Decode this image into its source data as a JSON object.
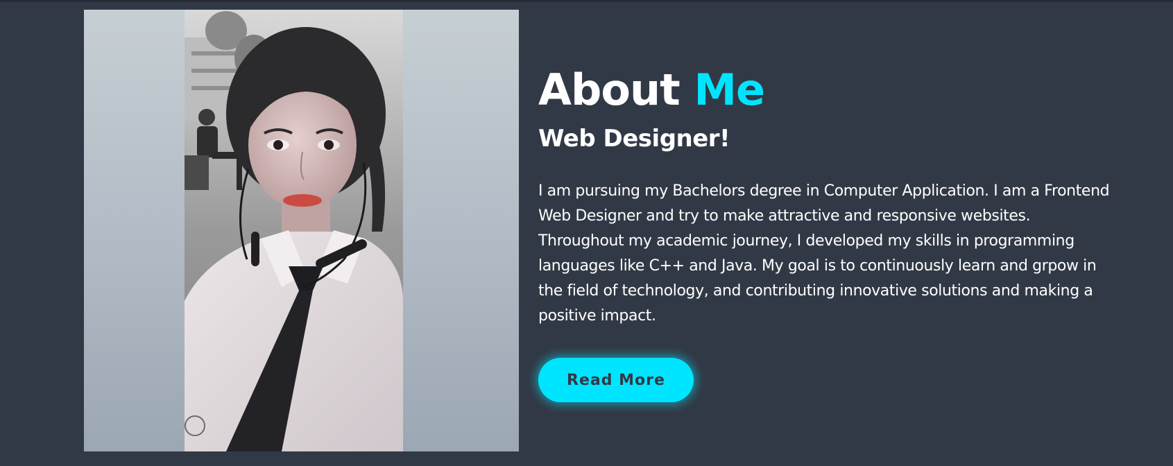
{
  "about": {
    "title_word": "About",
    "title_accent": "Me",
    "role": "Web Designer!",
    "bio": "I am pursuing my Bachelors degree in Computer Application. I am a Frontend Web Designer and try to make attractive and responsive websites. Throughout my academic journey, I developed my skills in programming languages like C++ and Java. My goal is to continuously learn and grpow in the field of technology, and contributing innovative solutions and making a positive impact.",
    "button_label": "Read More"
  },
  "colors": {
    "background": "#323946",
    "accent": "#00e5ff",
    "text": "#ffffff"
  }
}
